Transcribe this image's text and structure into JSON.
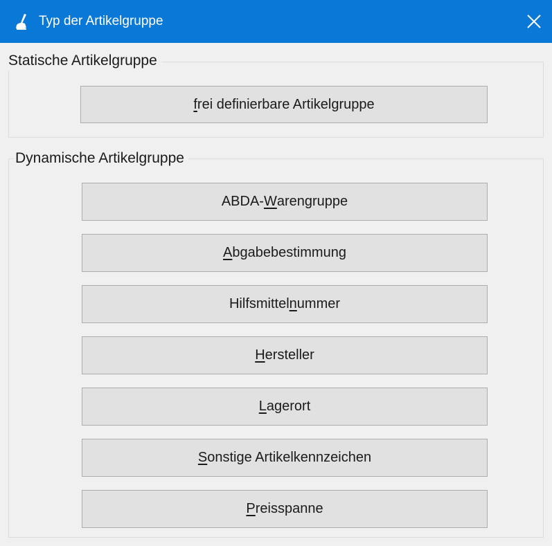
{
  "window": {
    "title": "Typ der Artikelgruppe",
    "title_icon": "brush-icon",
    "close_icon": "close-icon"
  },
  "static_group": {
    "legend": "Statische Artikelgruppe",
    "buttons": [
      {
        "pre": "",
        "mn": "f",
        "post": "rei definierbare Artikelgruppe"
      }
    ]
  },
  "dynamic_group": {
    "legend": "Dynamische Artikelgruppe",
    "buttons": [
      {
        "pre": "ABDA- ",
        "mn": "W",
        "post": "arengruppe"
      },
      {
        "pre": "",
        "mn": "A",
        "post": "bgabebestimmung"
      },
      {
        "pre": "Hilfsmittel",
        "mn": "n",
        "post": "ummer"
      },
      {
        "pre": "",
        "mn": "H",
        "post": "ersteller"
      },
      {
        "pre": "",
        "mn": "L",
        "post": "agerort"
      },
      {
        "pre": "",
        "mn": "S",
        "post": "onstige Artikelkennzeichen"
      },
      {
        "pre": "",
        "mn": "P",
        "post": "reisspanne"
      }
    ]
  },
  "colors": {
    "titlebar": "#0a78d7",
    "dialog_bg": "#f0f0f0",
    "button_bg": "#e1e1e1",
    "button_border": "#adadad"
  }
}
